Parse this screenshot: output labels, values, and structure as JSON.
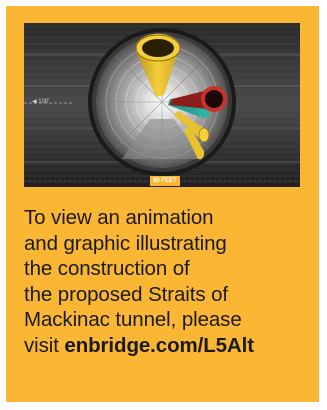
{
  "image": {
    "depth_label": "90 FEET",
    "side_label": "◀ 100'"
  },
  "caption": {
    "lines": [
      "To view an animation",
      "and graphic illustrating",
      "the construction of",
      "the proposed Straits of",
      "Mackinac tunnel, please"
    ],
    "last_line_prefix": "visit ",
    "link_text": "enbridge.com/L5Alt"
  },
  "colors": {
    "card_background": "#fbb733",
    "text": "#1a1a1a",
    "pipe_yellow": "#f5d03a",
    "pipe_teal": "#2db3a0",
    "pipe_red": "#c8322a"
  }
}
